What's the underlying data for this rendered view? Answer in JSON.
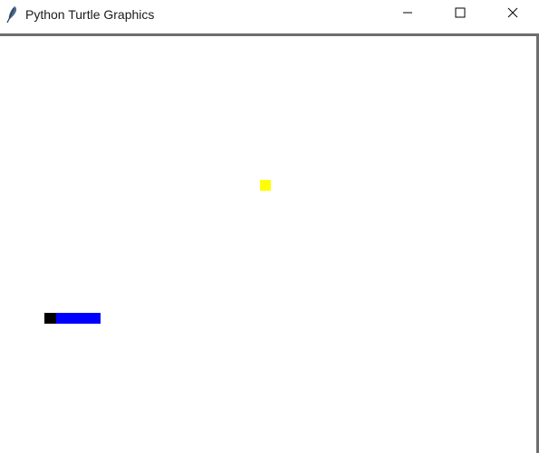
{
  "window": {
    "title": "Python Turtle Graphics",
    "app_icon": "feather-icon",
    "controls": {
      "minimize_icon": "minimize-icon",
      "maximize_icon": "maximize-icon",
      "close_icon": "close-icon"
    }
  },
  "canvas": {
    "background": "#ffffff",
    "food": {
      "color": "#ffff00",
      "shape": "square"
    },
    "snake": {
      "head_color": "#000000",
      "body_color": "#0000ff"
    }
  }
}
